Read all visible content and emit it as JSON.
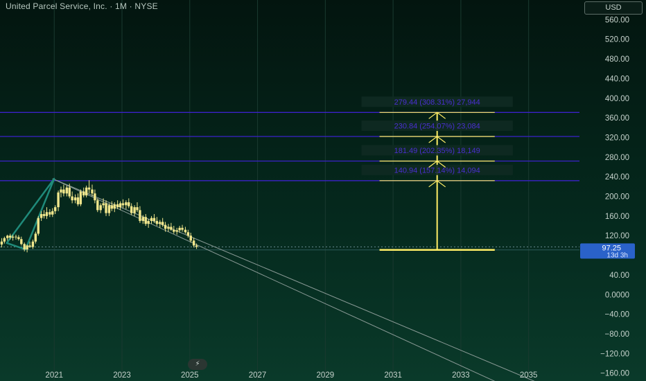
{
  "header": {
    "title": "United Parcel Service, Inc. · 1M · NYSE",
    "currency": "USD"
  },
  "price_badge": {
    "price": "97.25",
    "countdown": "13d 3h"
  },
  "colors": {
    "candle": "#f0e68c",
    "level_line": "#3b22c9",
    "measure": "#ffee66",
    "trend": "#8a9a96",
    "triangle": "#1f8a7a",
    "badge": "#2a62c9",
    "label_text": "#4a2fd0"
  },
  "icons": {
    "flash": "flash-icon"
  },
  "chart_data": {
    "type": "candlestick",
    "y_axis_labels": [
      "560.00",
      "520.00",
      "480.00",
      "440.00",
      "400.00",
      "360.00",
      "320.00",
      "280.00",
      "240.00",
      "200.00",
      "160.00",
      "120.00",
      "80.00",
      "40.00",
      "0.0000",
      "−40.00",
      "−80.00",
      "−120.00",
      "−160.00"
    ],
    "y_axis_values": [
      560,
      520,
      480,
      440,
      400,
      360,
      320,
      280,
      240,
      200,
      160,
      120,
      80,
      40,
      0,
      -40,
      -80,
      -120,
      -160
    ],
    "x_axis_labels": [
      "2021",
      "2023",
      "2025",
      "2027",
      "2029",
      "2031",
      "2033",
      "2035"
    ],
    "x_axis_years": [
      2021,
      2023,
      2025,
      2027,
      2029,
      2031,
      2033,
      2035
    ],
    "x_range": [
      2019.4,
      2036.5
    ],
    "y_range": [
      -176,
      600
    ],
    "last_price": 97.25,
    "measure_base": 91,
    "target_levels": [
      {
        "price": 232,
        "label": "140.94 (157.14%) 14,094"
      },
      {
        "price": 272,
        "label": "181.49 (202.35%) 18,149"
      },
      {
        "price": 322,
        "label": "230.84 (254.07%) 23,084"
      },
      {
        "price": 371,
        "label": "279.44 (308.31%) 27,944"
      }
    ],
    "measure_x_range": [
      2030.6,
      2034.0
    ],
    "trendlines": [
      {
        "from": [
          2020.95,
          236
        ],
        "to": [
          2034.3,
          -186
        ]
      },
      {
        "from": [
          2020.95,
          236
        ],
        "to": [
          2035.5,
          -186
        ]
      }
    ],
    "triangle": [
      [
        2019.6,
        105
      ],
      [
        2021.0,
        236
      ],
      [
        2020.15,
        92
      ]
    ],
    "candles": [
      {
        "t": 2019.45,
        "o": 102,
        "h": 115,
        "l": 96,
        "c": 108
      },
      {
        "t": 2019.53,
        "o": 108,
        "h": 118,
        "l": 104,
        "c": 115
      },
      {
        "t": 2019.62,
        "o": 115,
        "h": 122,
        "l": 110,
        "c": 120
      },
      {
        "t": 2019.7,
        "o": 120,
        "h": 124,
        "l": 112,
        "c": 116
      },
      {
        "t": 2019.78,
        "o": 116,
        "h": 122,
        "l": 110,
        "c": 118
      },
      {
        "t": 2019.87,
        "o": 118,
        "h": 122,
        "l": 112,
        "c": 117
      },
      {
        "t": 2019.95,
        "o": 117,
        "h": 121,
        "l": 110,
        "c": 113
      },
      {
        "t": 2020.03,
        "o": 113,
        "h": 118,
        "l": 100,
        "c": 103
      },
      {
        "t": 2020.12,
        "o": 103,
        "h": 106,
        "l": 88,
        "c": 92
      },
      {
        "t": 2020.2,
        "o": 92,
        "h": 102,
        "l": 86,
        "c": 100
      },
      {
        "t": 2020.28,
        "o": 100,
        "h": 108,
        "l": 95,
        "c": 97
      },
      {
        "t": 2020.37,
        "o": 97,
        "h": 112,
        "l": 93,
        "c": 108
      },
      {
        "t": 2020.45,
        "o": 108,
        "h": 128,
        "l": 104,
        "c": 124
      },
      {
        "t": 2020.53,
        "o": 124,
        "h": 160,
        "l": 120,
        "c": 156
      },
      {
        "t": 2020.62,
        "o": 156,
        "h": 170,
        "l": 150,
        "c": 164
      },
      {
        "t": 2020.7,
        "o": 164,
        "h": 172,
        "l": 155,
        "c": 160
      },
      {
        "t": 2020.78,
        "o": 160,
        "h": 178,
        "l": 154,
        "c": 168
      },
      {
        "t": 2020.87,
        "o": 168,
        "h": 174,
        "l": 158,
        "c": 163
      },
      {
        "t": 2020.95,
        "o": 163,
        "h": 176,
        "l": 158,
        "c": 170
      },
      {
        "t": 2021.03,
        "o": 170,
        "h": 182,
        "l": 164,
        "c": 178
      },
      {
        "t": 2021.12,
        "o": 178,
        "h": 212,
        "l": 170,
        "c": 208
      },
      {
        "t": 2021.2,
        "o": 208,
        "h": 220,
        "l": 198,
        "c": 214
      },
      {
        "t": 2021.28,
        "o": 214,
        "h": 224,
        "l": 200,
        "c": 206
      },
      {
        "t": 2021.37,
        "o": 206,
        "h": 222,
        "l": 200,
        "c": 218
      },
      {
        "t": 2021.45,
        "o": 218,
        "h": 226,
        "l": 196,
        "c": 200
      },
      {
        "t": 2021.53,
        "o": 200,
        "h": 210,
        "l": 186,
        "c": 192
      },
      {
        "t": 2021.62,
        "o": 192,
        "h": 204,
        "l": 186,
        "c": 198
      },
      {
        "t": 2021.7,
        "o": 198,
        "h": 206,
        "l": 180,
        "c": 184
      },
      {
        "t": 2021.78,
        "o": 184,
        "h": 214,
        "l": 180,
        "c": 210
      },
      {
        "t": 2021.87,
        "o": 210,
        "h": 218,
        "l": 198,
        "c": 202
      },
      {
        "t": 2021.95,
        "o": 202,
        "h": 222,
        "l": 198,
        "c": 218
      },
      {
        "t": 2022.03,
        "o": 218,
        "h": 233,
        "l": 206,
        "c": 214
      },
      {
        "t": 2022.12,
        "o": 214,
        "h": 224,
        "l": 200,
        "c": 206
      },
      {
        "t": 2022.2,
        "o": 206,
        "h": 214,
        "l": 186,
        "c": 192
      },
      {
        "t": 2022.28,
        "o": 192,
        "h": 196,
        "l": 168,
        "c": 172
      },
      {
        "t": 2022.37,
        "o": 172,
        "h": 186,
        "l": 166,
        "c": 182
      },
      {
        "t": 2022.45,
        "o": 182,
        "h": 196,
        "l": 176,
        "c": 186
      },
      {
        "t": 2022.53,
        "o": 186,
        "h": 192,
        "l": 160,
        "c": 166
      },
      {
        "t": 2022.62,
        "o": 166,
        "h": 186,
        "l": 160,
        "c": 182
      },
      {
        "t": 2022.7,
        "o": 182,
        "h": 190,
        "l": 170,
        "c": 175
      },
      {
        "t": 2022.78,
        "o": 175,
        "h": 188,
        "l": 168,
        "c": 184
      },
      {
        "t": 2022.87,
        "o": 184,
        "h": 192,
        "l": 174,
        "c": 178
      },
      {
        "t": 2022.95,
        "o": 178,
        "h": 190,
        "l": 172,
        "c": 186
      },
      {
        "t": 2023.03,
        "o": 186,
        "h": 194,
        "l": 176,
        "c": 182
      },
      {
        "t": 2023.12,
        "o": 182,
        "h": 192,
        "l": 174,
        "c": 188
      },
      {
        "t": 2023.2,
        "o": 188,
        "h": 196,
        "l": 176,
        "c": 180
      },
      {
        "t": 2023.28,
        "o": 180,
        "h": 186,
        "l": 162,
        "c": 166
      },
      {
        "t": 2023.37,
        "o": 166,
        "h": 182,
        "l": 160,
        "c": 178
      },
      {
        "t": 2023.45,
        "o": 178,
        "h": 188,
        "l": 168,
        "c": 172
      },
      {
        "t": 2023.53,
        "o": 172,
        "h": 180,
        "l": 146,
        "c": 150
      },
      {
        "t": 2023.62,
        "o": 150,
        "h": 162,
        "l": 144,
        "c": 158
      },
      {
        "t": 2023.7,
        "o": 158,
        "h": 164,
        "l": 140,
        "c": 144
      },
      {
        "t": 2023.78,
        "o": 144,
        "h": 154,
        "l": 136,
        "c": 150
      },
      {
        "t": 2023.87,
        "o": 150,
        "h": 160,
        "l": 144,
        "c": 156
      },
      {
        "t": 2023.95,
        "o": 156,
        "h": 164,
        "l": 146,
        "c": 150
      },
      {
        "t": 2024.03,
        "o": 150,
        "h": 158,
        "l": 140,
        "c": 144
      },
      {
        "t": 2024.12,
        "o": 144,
        "h": 152,
        "l": 136,
        "c": 148
      },
      {
        "t": 2024.2,
        "o": 148,
        "h": 156,
        "l": 138,
        "c": 142
      },
      {
        "t": 2024.28,
        "o": 142,
        "h": 148,
        "l": 128,
        "c": 134
      },
      {
        "t": 2024.37,
        "o": 134,
        "h": 144,
        "l": 128,
        "c": 138
      },
      {
        "t": 2024.45,
        "o": 138,
        "h": 146,
        "l": 130,
        "c": 132
      },
      {
        "t": 2024.53,
        "o": 132,
        "h": 140,
        "l": 124,
        "c": 128
      },
      {
        "t": 2024.62,
        "o": 128,
        "h": 136,
        "l": 122,
        "c": 131
      },
      {
        "t": 2024.7,
        "o": 131,
        "h": 140,
        "l": 126,
        "c": 136
      },
      {
        "t": 2024.78,
        "o": 136,
        "h": 142,
        "l": 128,
        "c": 132
      },
      {
        "t": 2024.87,
        "o": 132,
        "h": 138,
        "l": 124,
        "c": 127
      },
      {
        "t": 2024.95,
        "o": 127,
        "h": 132,
        "l": 116,
        "c": 120
      },
      {
        "t": 2025.03,
        "o": 120,
        "h": 126,
        "l": 106,
        "c": 110
      },
      {
        "t": 2025.12,
        "o": 110,
        "h": 116,
        "l": 96,
        "c": 100
      },
      {
        "t": 2025.2,
        "o": 100,
        "h": 104,
        "l": 93,
        "c": 97.25
      }
    ]
  }
}
